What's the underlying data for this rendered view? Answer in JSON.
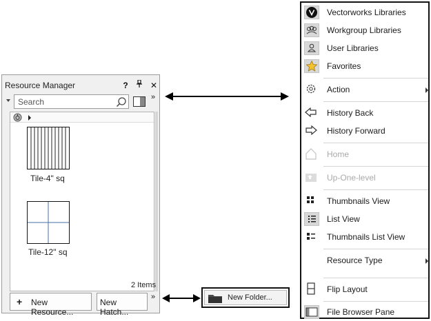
{
  "resource_manager": {
    "title": "Resource Manager",
    "help_label": "?",
    "pin_label": "⭧",
    "close_label": "✕",
    "overflow_label": "»",
    "search": {
      "placeholder": "Search"
    },
    "resources": [
      {
        "name": "Tile-4\" sq"
      },
      {
        "name": "Tile-12\" sq"
      }
    ],
    "item_count": "2 Items",
    "new_resource_label": "New Resource...",
    "new_hatch_label": "New Hatch...",
    "add_glyph": "+"
  },
  "menu": {
    "libraries": [
      {
        "label": "Vectorworks Libraries",
        "icon": "vectorworks-logo-icon"
      },
      {
        "label": "Workgroup Libraries",
        "icon": "workgroup-icon"
      },
      {
        "label": "User Libraries",
        "icon": "user-icon"
      },
      {
        "label": "Favorites",
        "icon": "star-icon"
      }
    ],
    "action": {
      "label": "Action",
      "icon": "gear-icon"
    },
    "history_back": {
      "label": "History Back",
      "icon": "arrow-left-icon"
    },
    "history_forward": {
      "label": "History Forward",
      "icon": "arrow-right-icon"
    },
    "home": {
      "label": "Home",
      "icon": "home-icon",
      "enabled": false
    },
    "up_one_level": {
      "label": "Up-One-level",
      "icon": "folder-up-icon",
      "enabled": false
    },
    "thumbnails_view": {
      "label": "Thumbnails View",
      "icon": "grid-icon"
    },
    "list_view": {
      "label": "List View",
      "icon": "list-icon",
      "selected": true
    },
    "thumbnails_list_view": {
      "label": "Thumbnails List View",
      "icon": "thumb-list-icon"
    },
    "resource_type": {
      "label": "Resource Type"
    },
    "flip_layout": {
      "label": "Flip Layout",
      "icon": "flip-icon"
    },
    "file_browser_pane": {
      "label": "File Browser Pane",
      "icon": "pane-icon"
    }
  },
  "new_folder": {
    "label": "New Folder..."
  },
  "colors": {
    "accent_highlight": "#d8d8d8",
    "star": "#f2c230",
    "tile_grid_line": "#4a6fa5"
  }
}
